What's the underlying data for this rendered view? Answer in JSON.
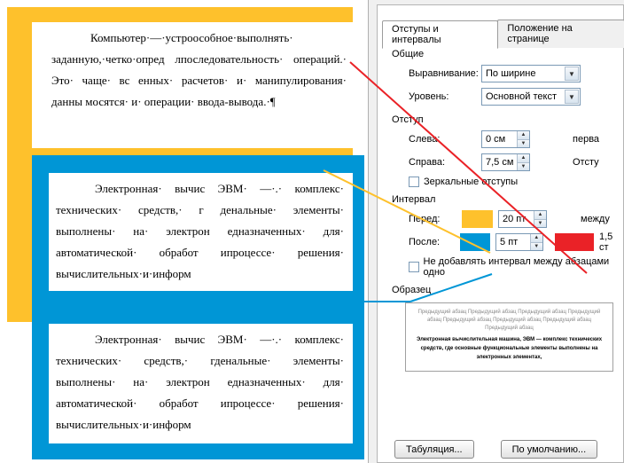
{
  "paragraphs": {
    "p1": "Компьютер·—·устроособное·выполнять· заданную,·четко·опред лпоследовательность· операций.· Это· чаще· вс енных· расчетов· и· манипулирования· данны мосятся· и· операции· ввода-вывода.·¶",
    "p2": "Электронная· вычис ЭВМ· —·.· комплекс· технических· средств,· г денальные· элементы· выполнены· на· электрон едназначенных· для· автоматической· обработ ипроцессе· решения· вычислительных·и·информ",
    "p3": "Электронная· вычис ЭВМ· —·.· комплекс· технических· средств,· гденальные· элементы· выполнены· на· электрон едназначенных· для· автоматической· обработ ипроцессе· решения· вычислительных·и·информ"
  },
  "tabs": {
    "active": "Отступы и интервалы",
    "inactive": "Положение на странице"
  },
  "groups": {
    "general": "Общие",
    "indent": "Отступ",
    "spacing": "Интервал",
    "sample": "Образец"
  },
  "labels": {
    "alignment": "Выравнивание:",
    "level": "Уровень:",
    "left": "Слева:",
    "right": "Справа:",
    "mirror": "Зеркальные отступы",
    "before": "Перед:",
    "after": "После:",
    "noadd": "Не добавлять интервал между абзацами одно",
    "first": "перва",
    "hang": "Отсту",
    "between": "между",
    "val15": "1,5 ст"
  },
  "values": {
    "alignment": "По ширине",
    "level": "Основной текст",
    "left": "0 см",
    "right": "7,5 см",
    "before": "20 пт",
    "after": "5 пт"
  },
  "buttons": {
    "tabs": "Табуляция...",
    "default": "По умолчанию..."
  },
  "preview": {
    "grey": "Предыдущий абзац Предыдущий абзац Предыдущий абзац Предыдущий абзац Предыдущий абзац Предыдущий абзац Предыдущий абзац Предыдущий абзац",
    "main": "Электронная вычислительная машина, ЭВМ — комплекс технических средств, где основные функциональные элементы выполнены на электронных элементах,"
  }
}
